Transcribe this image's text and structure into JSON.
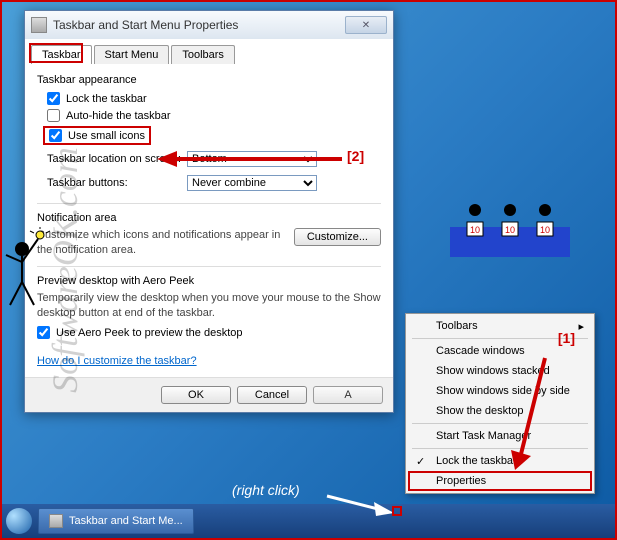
{
  "dialog": {
    "title": "Taskbar and Start Menu Properties",
    "tabs": [
      "Taskbar",
      "Start Menu",
      "Toolbars"
    ],
    "appearance_label": "Taskbar appearance",
    "lock_label": "Lock the taskbar",
    "autohide_label": "Auto-hide the taskbar",
    "smallicons_label": "Use small icons",
    "location_label": "Taskbar location on screen:",
    "location_value": "Bottom",
    "buttons_label": "Taskbar buttons:",
    "buttons_value": "Never combine",
    "notif_label": "Notification area",
    "notif_desc": "Customize which icons and notifications appear in the notification area.",
    "customize_btn": "Customize...",
    "peek_label": "Preview desktop with Aero Peek",
    "peek_desc": "Temporarily view the desktop when you move your mouse to the Show desktop button at end of the taskbar.",
    "peek_check": "Use Aero Peek to preview the desktop",
    "help_link": "How do I customize the taskbar?",
    "ok": "OK",
    "cancel": "Cancel",
    "apply": "Apply"
  },
  "context": {
    "toolbars": "Toolbars",
    "cascade": "Cascade windows",
    "stacked": "Show windows stacked",
    "sidebyside": "Show windows side by side",
    "showdesktop": "Show the desktop",
    "taskmgr": "Start Task Manager",
    "lock": "Lock the taskbar",
    "properties": "Properties"
  },
  "taskbar": {
    "item": "Taskbar and Start Me..."
  },
  "annotations": {
    "marker1": "[1]",
    "marker2": "[2]",
    "rightclick": "(right click)"
  },
  "watermark": "SoftwareOK.com"
}
